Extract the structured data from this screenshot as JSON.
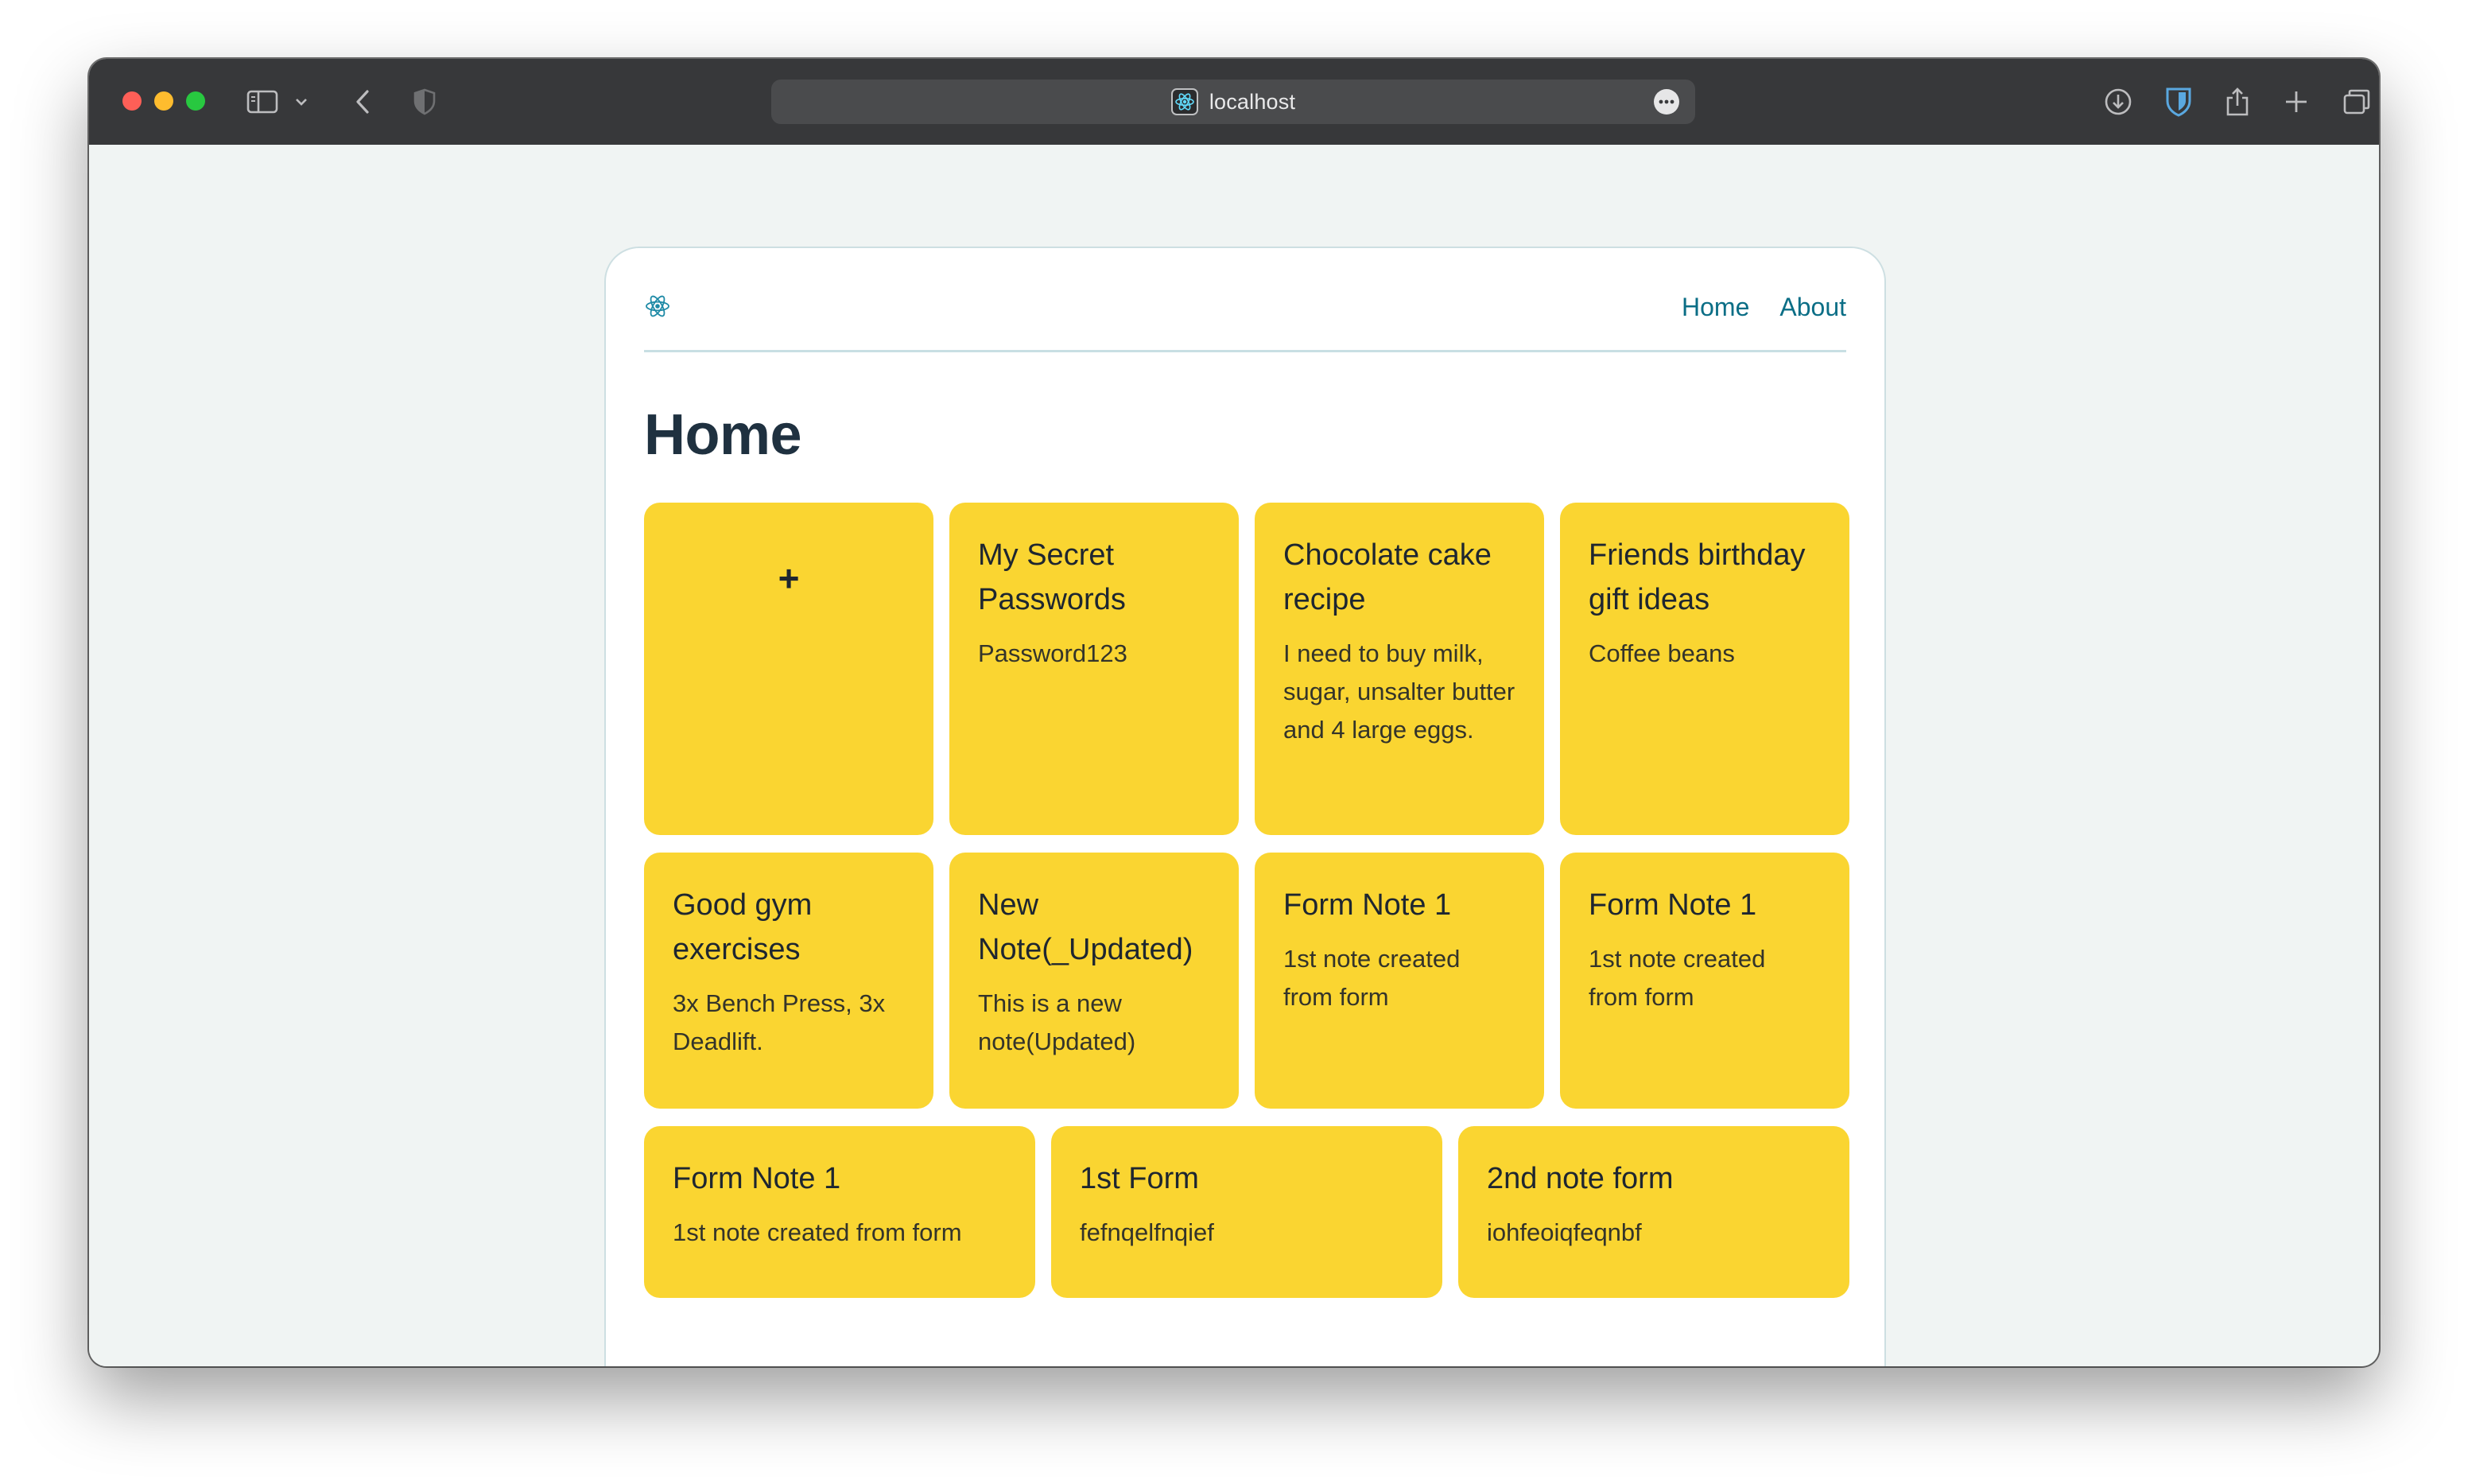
{
  "browser": {
    "url": "localhost",
    "toolbar_icons": [
      "sidebar-icon",
      "chevron-down-icon",
      "back-icon",
      "shield-icon",
      "more-icon",
      "download-icon",
      "bitwarden-icon",
      "share-icon",
      "new-tab-icon",
      "tabs-overview-icon"
    ]
  },
  "nav": {
    "logo": "react-logo-icon",
    "links": [
      "Home",
      "About"
    ]
  },
  "page": {
    "title": "Home"
  },
  "add_note": {
    "symbol": "+"
  },
  "notes": [
    {
      "title": "My Secret Passwords",
      "body": "Password123"
    },
    {
      "title": "Chocolate cake recipe",
      "body": "I need to buy milk, sugar, unsalter butter and 4 large eggs."
    },
    {
      "title": "Friends birthday gift ideas",
      "body": "Coffee beans"
    },
    {
      "title": "Good gym exercises",
      "body": "3x Bench Press, 3x Deadlift."
    },
    {
      "title": "New Note(_Updated)",
      "body": "This is a new note(Updated)"
    },
    {
      "title": "Form Note 1",
      "body": "1st note created from form"
    },
    {
      "title": "Form Note 1",
      "body": "1st note created from form"
    },
    {
      "title": "Form Note 1",
      "body": "1st note created from form"
    },
    {
      "title": "1st Form",
      "body": "fefnqelfnqief"
    },
    {
      "title": "2nd note form",
      "body": "iohfeoiqfeqnbf"
    }
  ],
  "colors": {
    "note_background": "#fad531",
    "link": "#0b6e86",
    "title_text": "#1f3140",
    "browser_chrome": "#37383a"
  }
}
